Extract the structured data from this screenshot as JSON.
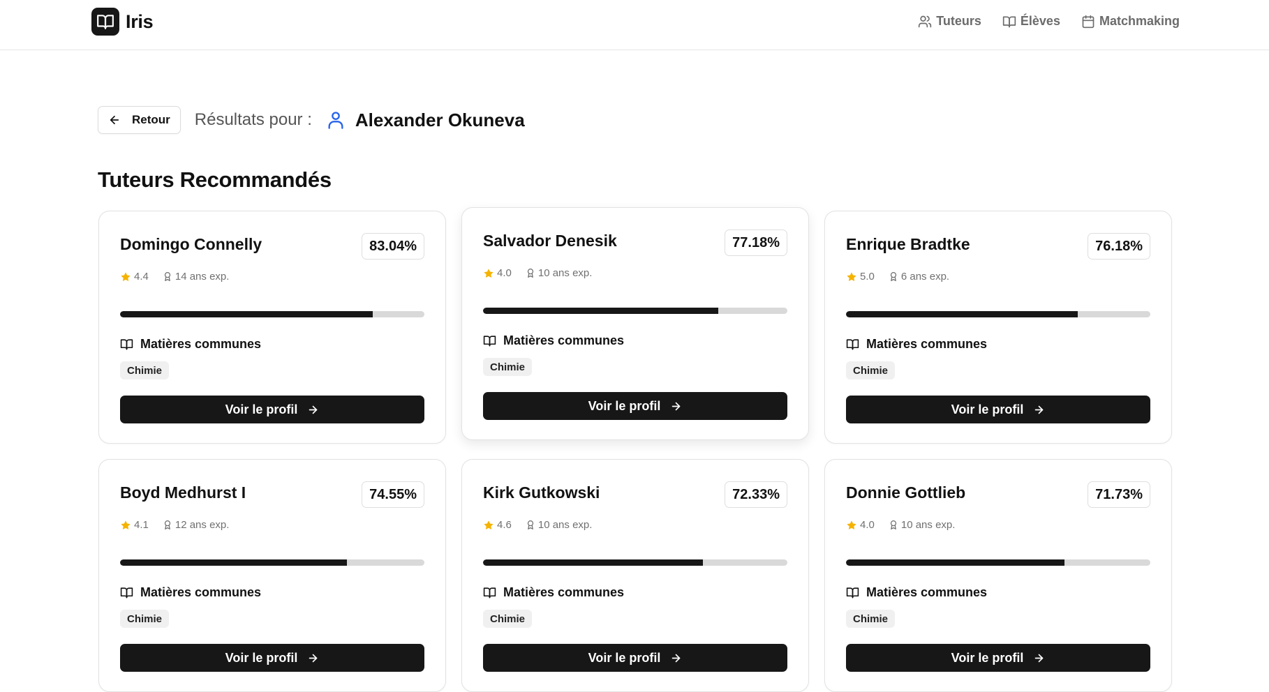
{
  "app": {
    "name": "Iris",
    "logo_icon": "open-book-icon"
  },
  "nav": {
    "items": [
      {
        "label": "Tuteurs",
        "icon": "users-icon"
      },
      {
        "label": "Élèves",
        "icon": "book-icon"
      },
      {
        "label": "Matchmaking",
        "icon": "calendar-icon"
      }
    ]
  },
  "toolbar": {
    "back_label": "Retour",
    "results_label": "Résultats pour :",
    "student_name": "Alexander Okuneva",
    "student_icon_color": "#2563eb"
  },
  "section": {
    "title": "Tuteurs Recommandés"
  },
  "colors": {
    "star": "#f5b301",
    "dark": "#171717",
    "track": "#d9d9d9"
  },
  "tutors": [
    {
      "name": "Domingo Connelly",
      "score": "83.04%",
      "score_value": 83.04,
      "rating": "4.4",
      "experience": "14 ans exp.",
      "subjects_label": "Matières communes",
      "subjects": [
        "Chimie"
      ],
      "cta": "Voir le profil"
    },
    {
      "name": "Salvador Denesik",
      "score": "77.18%",
      "score_value": 77.18,
      "rating": "4.0",
      "experience": "10 ans exp.",
      "subjects_label": "Matières communes",
      "subjects": [
        "Chimie"
      ],
      "cta": "Voir le profil"
    },
    {
      "name": "Enrique Bradtke",
      "score": "76.18%",
      "score_value": 76.18,
      "rating": "5.0",
      "experience": "6 ans exp.",
      "subjects_label": "Matières communes",
      "subjects": [
        "Chimie"
      ],
      "cta": "Voir le profil"
    },
    {
      "name": "Boyd Medhurst I",
      "score": "74.55%",
      "score_value": 74.55,
      "rating": "4.1",
      "experience": "12 ans exp.",
      "subjects_label": "Matières communes",
      "subjects": [
        "Chimie"
      ],
      "cta": "Voir le profil"
    },
    {
      "name": "Kirk Gutkowski",
      "score": "72.33%",
      "score_value": 72.33,
      "rating": "4.6",
      "experience": "10 ans exp.",
      "subjects_label": "Matières communes",
      "subjects": [
        "Chimie"
      ],
      "cta": "Voir le profil"
    },
    {
      "name": "Donnie Gottlieb",
      "score": "71.73%",
      "score_value": 71.73,
      "rating": "4.0",
      "experience": "10 ans exp.",
      "subjects_label": "Matières communes",
      "subjects": [
        "Chimie"
      ],
      "cta": "Voir le profil"
    }
  ]
}
